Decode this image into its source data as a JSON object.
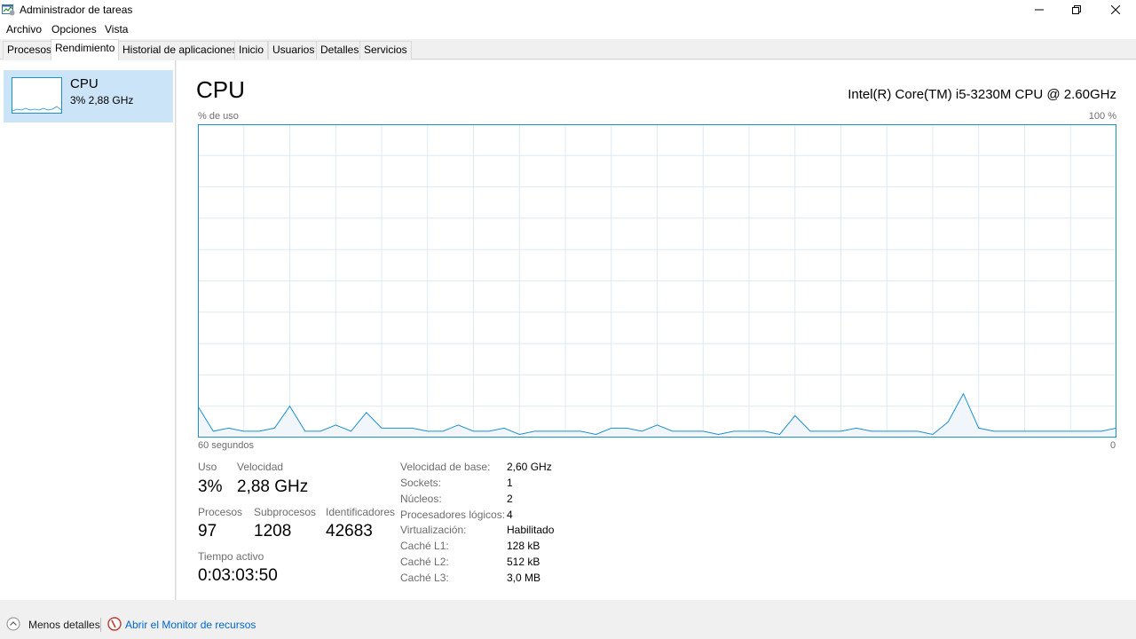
{
  "window": {
    "title": "Administrador de tareas",
    "icons": {
      "app": "task-manager-icon",
      "minimize": "minimize-icon",
      "restore": "restore-icon",
      "close": "close-icon"
    }
  },
  "menu": [
    "Archivo",
    "Opciones",
    "Vista"
  ],
  "tabs": [
    "Procesos",
    "Rendimiento",
    "Historial de aplicaciones",
    "Inicio",
    "Usuarios",
    "Detalles",
    "Servicios"
  ],
  "active_tab": "Rendimiento",
  "sidebar": {
    "items": [
      {
        "name": "CPU",
        "subtitle": "3% 2,88 GHz",
        "selected": true
      }
    ]
  },
  "main": {
    "title": "CPU",
    "cpu_model": "Intel(R) Core(TM) i5-3230M CPU @ 2.60GHz",
    "y_label": "% de uso",
    "y_max_label": "100 %",
    "x_left_label": "60 segundos",
    "x_right_label": "0"
  },
  "chart_data": {
    "type": "area",
    "ylim": [
      0,
      100
    ],
    "x_seconds_ago": [
      60,
      59,
      58,
      57,
      56,
      55,
      54,
      53,
      52,
      51,
      50,
      49,
      48,
      47,
      46,
      45,
      44,
      43,
      42,
      41,
      40,
      39,
      38,
      37,
      36,
      35,
      34,
      33,
      32,
      31,
      30,
      29,
      28,
      27,
      26,
      25,
      24,
      23,
      22,
      21,
      20,
      19,
      18,
      17,
      16,
      15,
      14,
      13,
      12,
      11,
      10,
      9,
      8,
      7,
      6,
      5,
      4,
      3,
      2,
      1,
      0
    ],
    "values": [
      10,
      2,
      3,
      2,
      2,
      3,
      10,
      2,
      2,
      4,
      2,
      8,
      3,
      3,
      3,
      2,
      2,
      4,
      2,
      2,
      3,
      1,
      2,
      2,
      2,
      2,
      1,
      3,
      3,
      2,
      4,
      2,
      2,
      2,
      1,
      2,
      2,
      2,
      1,
      7,
      2,
      2,
      2,
      3,
      2,
      2,
      2,
      2,
      1,
      5,
      14,
      3,
      2,
      2,
      2,
      2,
      2,
      2,
      2,
      2,
      3
    ],
    "grid": true,
    "color": "#1c8fd0",
    "fill": "#f1f6fb"
  },
  "stats": {
    "uso": {
      "label": "Uso",
      "value": "3%"
    },
    "velocidad": {
      "label": "Velocidad",
      "value": "2,88 GHz"
    },
    "procesos": {
      "label": "Procesos",
      "value": "97"
    },
    "subprocesos": {
      "label": "Subprocesos",
      "value": "1208"
    },
    "identificadores": {
      "label": "Identificadores",
      "value": "42683"
    },
    "tiempo": {
      "label": "Tiempo activo",
      "value": "0:03:03:50"
    }
  },
  "info": [
    {
      "label": "Velocidad de base:",
      "value": "2,60 GHz"
    },
    {
      "label": "Sockets:",
      "value": "1"
    },
    {
      "label": "Núcleos:",
      "value": "2"
    },
    {
      "label": "Procesadores lógicos:",
      "value": "4"
    },
    {
      "label": "Virtualización:",
      "value": "Habilitado"
    },
    {
      "label": "Caché L1:",
      "value": "128 kB"
    },
    {
      "label": "Caché L2:",
      "value": "512 kB"
    },
    {
      "label": "Caché L3:",
      "value": "3,0 MB"
    }
  ],
  "footer": {
    "less_details": "Menos detalles",
    "resource_monitor": "Abrir el Monitor de recursos",
    "link_color": "#0066cc"
  }
}
